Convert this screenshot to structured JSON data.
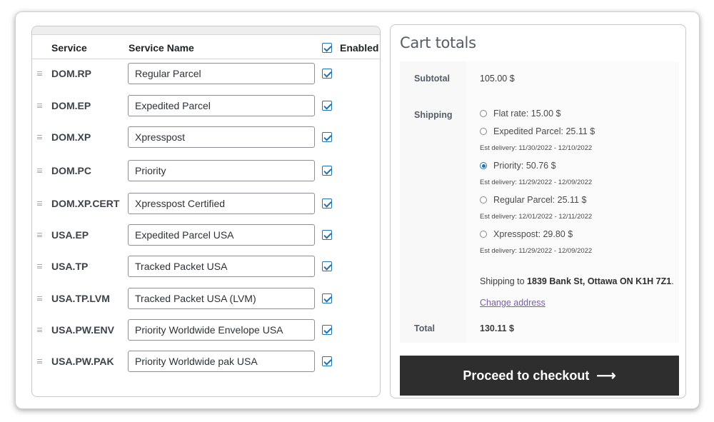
{
  "services_table": {
    "headers": {
      "service": "Service",
      "service_name": "Service Name",
      "enabled": "Enabled"
    },
    "rows": [
      {
        "code": "DOM.RP",
        "name": "Regular Parcel",
        "enabled": true
      },
      {
        "code": "DOM.EP",
        "name": "Expedited Parcel",
        "enabled": true
      },
      {
        "code": "DOM.XP",
        "name": "Xpresspost",
        "enabled": true
      },
      {
        "code": "DOM.PC",
        "name": "Priority",
        "enabled": true
      },
      {
        "code": "DOM.XP.CERT",
        "name": "Xpresspost Certified",
        "enabled": true
      },
      {
        "code": "USA.EP",
        "name": "Expedited Parcel USA",
        "enabled": true
      },
      {
        "code": "USA.TP",
        "name": "Tracked Packet USA",
        "enabled": true
      },
      {
        "code": "USA.TP.LVM",
        "name": "Tracked Packet USA (LVM)",
        "enabled": true
      },
      {
        "code": "USA.PW.ENV",
        "name": "Priority Worldwide Envelope USA",
        "enabled": true
      },
      {
        "code": "USA.PW.PAK",
        "name": "Priority Worldwide pak USA",
        "enabled": true
      }
    ]
  },
  "cart": {
    "title": "Cart totals",
    "subtotal_label": "Subtotal",
    "subtotal_value": "105.00 $",
    "shipping_label": "Shipping",
    "shipping_options": [
      {
        "label": "Flat rate: 15.00 $",
        "est": "",
        "selected": false
      },
      {
        "label": "Expedited Parcel: 25.11 $",
        "est": "Est delivery: 11/30/2022 - 12/10/2022",
        "selected": false
      },
      {
        "label": "Priority: 50.76 $",
        "est": "Est delivery: 11/29/2022 - 12/09/2022",
        "selected": true
      },
      {
        "label": "Regular Parcel: 25.11 $",
        "est": "Est delivery: 12/01/2022 - 12/11/2022",
        "selected": false
      },
      {
        "label": "Xpresspost: 29.80 $",
        "est": "Est delivery: 11/29/2022 - 12/09/2022",
        "selected": false
      }
    ],
    "shipping_to_prefix": "Shipping to",
    "shipping_address": "1839 Bank St, Ottawa ON K1H 7Z1",
    "shipping_to_suffix": ".",
    "change_address": "Change address",
    "total_label": "Total",
    "total_value": "130.11 $",
    "checkout_label": "Proceed to checkout",
    "checkout_arrow": "⟶"
  },
  "colors": {
    "accent": "#2271b1",
    "checkout_bg": "#2e2e2e",
    "link": "#7a5ca8"
  }
}
